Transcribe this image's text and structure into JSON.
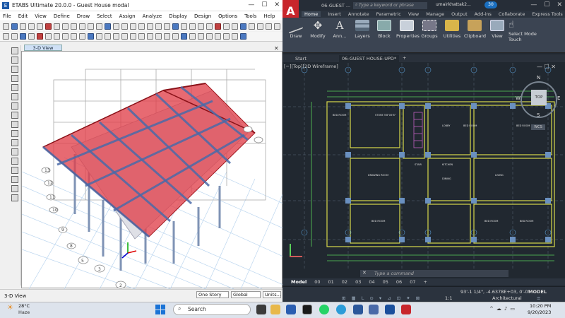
{
  "etabs": {
    "title": "ETABS Ultimate 20.0.0 - Guest House modal",
    "menu": [
      "File",
      "Edit",
      "View",
      "Define",
      "Draw",
      "Select",
      "Assign",
      "Analyze",
      "Display",
      "Design",
      "Options",
      "Tools",
      "Help"
    ],
    "view_tab": "3-D View",
    "status_label": "3-D View",
    "story_select": "One Story",
    "coord_select": "Global",
    "units_button": "Units...",
    "grid_labels": [
      "1",
      "2",
      "3",
      "4",
      "5",
      "6",
      "7",
      "8",
      "9",
      "10",
      "11",
      "12",
      "13"
    ]
  },
  "autocad": {
    "window_title": "06-GUEST ...",
    "search_placeholder": "Type a keyword or phrase",
    "user": "umairkhattak2...",
    "notif_count": "30",
    "ribbon_tabs": [
      "Home",
      "Insert",
      "Annotate",
      "Parametric",
      "View",
      "Manage",
      "Output",
      "Add-ins",
      "Collaborate",
      "Express Tools"
    ],
    "ribbon_buttons": [
      "Draw",
      "Modify",
      "Ann...",
      "Layers",
      "Block",
      "Properties",
      "Groups",
      "Utilities",
      "Clipboard",
      "View"
    ],
    "select_mode": "Select Mode",
    "touch": "Touch",
    "doc_tabs": [
      "Start",
      "06-GUEST HOUSE-UPD*"
    ],
    "viewport_label": "[−][Top][2D Wireframe]",
    "viewcube": {
      "top": "TOP",
      "n": "N",
      "w": "W",
      "e": "E",
      "s": "S",
      "wcs": "WCS"
    },
    "room_labels": [
      "BED ROOM",
      "STORE 5'8\"X5'8\"",
      "STAIR",
      "KITCHEN",
      "BED ROOM",
      "DRAWING ROOM",
      "LOBBY",
      "DINING",
      "LIVING",
      "BED ROOM",
      "BED ROOM",
      "BED ROOM",
      "BED ROOM"
    ],
    "command_placeholder": "Type a command",
    "layout_tabs": [
      "Model",
      "00",
      "01",
      "02",
      "03",
      "04",
      "05",
      "06",
      "07"
    ],
    "coords": "93'-1 1/4\", -4.6378E+03, 0'-0\"",
    "model_label": "MODEL",
    "scale": "1:1",
    "annotation_style": "Architectural"
  },
  "taskbar": {
    "temp": "28°C",
    "weather": "Haze",
    "search": "Search",
    "time": "10:20 PM",
    "date": "9/20/2023"
  }
}
